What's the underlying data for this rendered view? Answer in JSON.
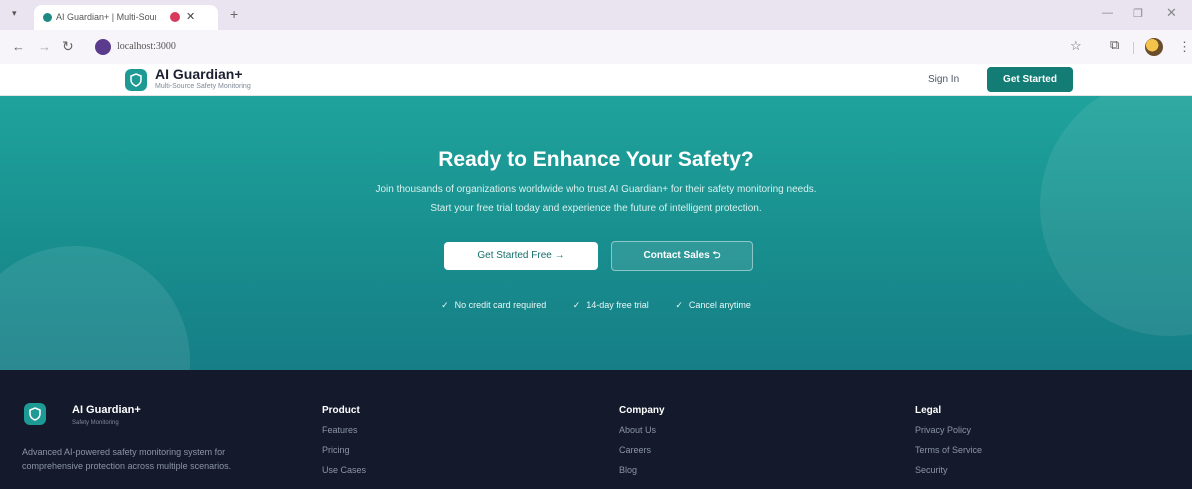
{
  "browser": {
    "tab_title": "AI Guardian+ | Multi-Sourc",
    "url": "localhost:3000"
  },
  "header": {
    "brand_name": "AI Guardian+",
    "brand_sub": "Multi-Source Safety Monitoring",
    "sign_in": "Sign In",
    "get_started": "Get Started"
  },
  "hero": {
    "title": "Ready to Enhance Your Safety?",
    "line1": "Join thousands of organizations worldwide who trust AI Guardian+ for their safety monitoring needs.",
    "line2": "Start your free trial today and experience the future of intelligent protection.",
    "primary_button": "Get Started Free →",
    "secondary_button": "Contact Sales ⮌",
    "checks": [
      "No credit card required",
      "14-day free trial",
      "Cancel anytime"
    ]
  },
  "footer": {
    "brand_name": "AI Guardian+",
    "brand_sub": "Safety Monitoring",
    "description": "Advanced AI-powered safety monitoring system for comprehensive protection across multiple scenarios.",
    "columns": [
      {
        "heading": "Product",
        "links": [
          "Features",
          "Pricing",
          "Use Cases"
        ]
      },
      {
        "heading": "Company",
        "links": [
          "About Us",
          "Careers",
          "Blog"
        ]
      },
      {
        "heading": "Legal",
        "links": [
          "Privacy Policy",
          "Terms of Service",
          "Security"
        ]
      }
    ]
  },
  "colors": {
    "brand_teal": "#1e9a95",
    "button_teal": "#127c75",
    "footer_bg": "#141a2b"
  }
}
